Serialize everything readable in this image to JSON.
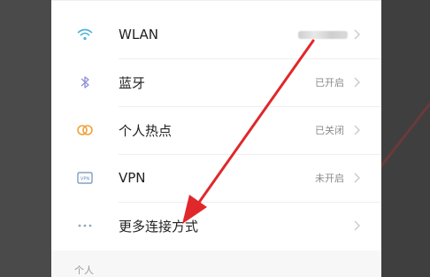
{
  "settings": {
    "items": [
      {
        "label": "WLAN",
        "status": "",
        "icon": "wifi-icon"
      },
      {
        "label": "蓝牙",
        "status": "已开启",
        "icon": "bluetooth-icon"
      },
      {
        "label": "个人热点",
        "status": "已关闭",
        "icon": "hotspot-icon"
      },
      {
        "label": "VPN",
        "status": "未开启",
        "icon": "vpn-icon"
      },
      {
        "label": "更多连接方式",
        "status": "",
        "icon": "more-dots-icon"
      }
    ],
    "next_section_title": "个人"
  },
  "colors": {
    "wifi": "#4fb3d9",
    "bluetooth": "#8a8fd6",
    "hotspot": "#f0a23a",
    "vpn": "#6b8fb8",
    "more": "#8fa9b8",
    "annotation_arrow": "#e0282a"
  }
}
